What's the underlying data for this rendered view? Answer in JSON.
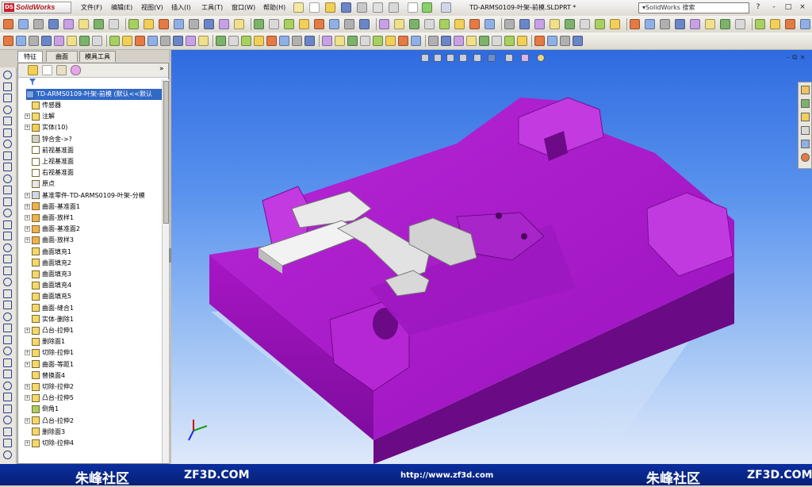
{
  "app": {
    "logo_text": "SolidWorks",
    "logo_badge": "DS"
  },
  "menu": [
    "文件(F)",
    "编辑(E)",
    "视图(V)",
    "插入(I)",
    "工具(T)",
    "窗口(W)",
    "帮助(H)"
  ],
  "document_title": "TD-ARMS0109-叶架-前模.SLDPRT *",
  "search": {
    "placeholder": "SolidWorks 搜索"
  },
  "window_buttons": [
    "?",
    "-",
    "□",
    "×"
  ],
  "panel_tabs": [
    "特征",
    "曲面",
    "模具工具"
  ],
  "feature_tree": {
    "root": "TD-ARMS0109-叶架-前模 (默认<<默认",
    "items": [
      {
        "label": "传感器",
        "expand": ""
      },
      {
        "label": "注解",
        "expand": "+"
      },
      {
        "label": "实体(10)",
        "expand": "+"
      },
      {
        "label": "锌合金->?",
        "expand": ""
      },
      {
        "label": "前视基准面",
        "expand": ""
      },
      {
        "label": "上视基准面",
        "expand": ""
      },
      {
        "label": "右视基准面",
        "expand": ""
      },
      {
        "label": "原点",
        "expand": ""
      },
      {
        "label": "基准零件-TD-ARMS0109-叶架-分模",
        "expand": "+"
      },
      {
        "label": "曲面-基准面1",
        "expand": "+"
      },
      {
        "label": "曲面-放样1",
        "expand": "+"
      },
      {
        "label": "曲面-基准面2",
        "expand": "+"
      },
      {
        "label": "曲面-放样3",
        "expand": "+"
      },
      {
        "label": "曲面填充1",
        "expand": ""
      },
      {
        "label": "曲面填充2",
        "expand": ""
      },
      {
        "label": "曲面填充3",
        "expand": ""
      },
      {
        "label": "曲面填充4",
        "expand": ""
      },
      {
        "label": "曲面填充5",
        "expand": ""
      },
      {
        "label": "曲面-缝合1",
        "expand": ""
      },
      {
        "label": "实体-删除1",
        "expand": ""
      },
      {
        "label": "凸台-拉伸1",
        "expand": "+"
      },
      {
        "label": "删除面1",
        "expand": ""
      },
      {
        "label": "切除-拉伸1",
        "expand": "+"
      },
      {
        "label": "曲面-等距1",
        "expand": "+"
      },
      {
        "label": "替换面4",
        "expand": ""
      },
      {
        "label": "切除-拉伸2",
        "expand": "+"
      },
      {
        "label": "凸台-拉伸5",
        "expand": "+"
      },
      {
        "label": "倒角1",
        "expand": ""
      },
      {
        "label": "凸台-拉伸2",
        "expand": "+"
      },
      {
        "label": "删除面3",
        "expand": ""
      },
      {
        "label": "切除-拉伸4",
        "expand": "+"
      }
    ]
  },
  "footer": {
    "brand_left": "朱峰社区",
    "site_left": "ZF3D.COM",
    "url": "http://www.zf3d.com",
    "brand_right": "朱峰社区",
    "site_right": "ZF3D.COM"
  },
  "colors": {
    "part": "#a316c4",
    "part_dark": "#6a0a85",
    "part_light": "#c23ae0",
    "insert": "#e9e9e9",
    "footer": "#0a2b95",
    "viewport_top": "#2f6be0"
  }
}
